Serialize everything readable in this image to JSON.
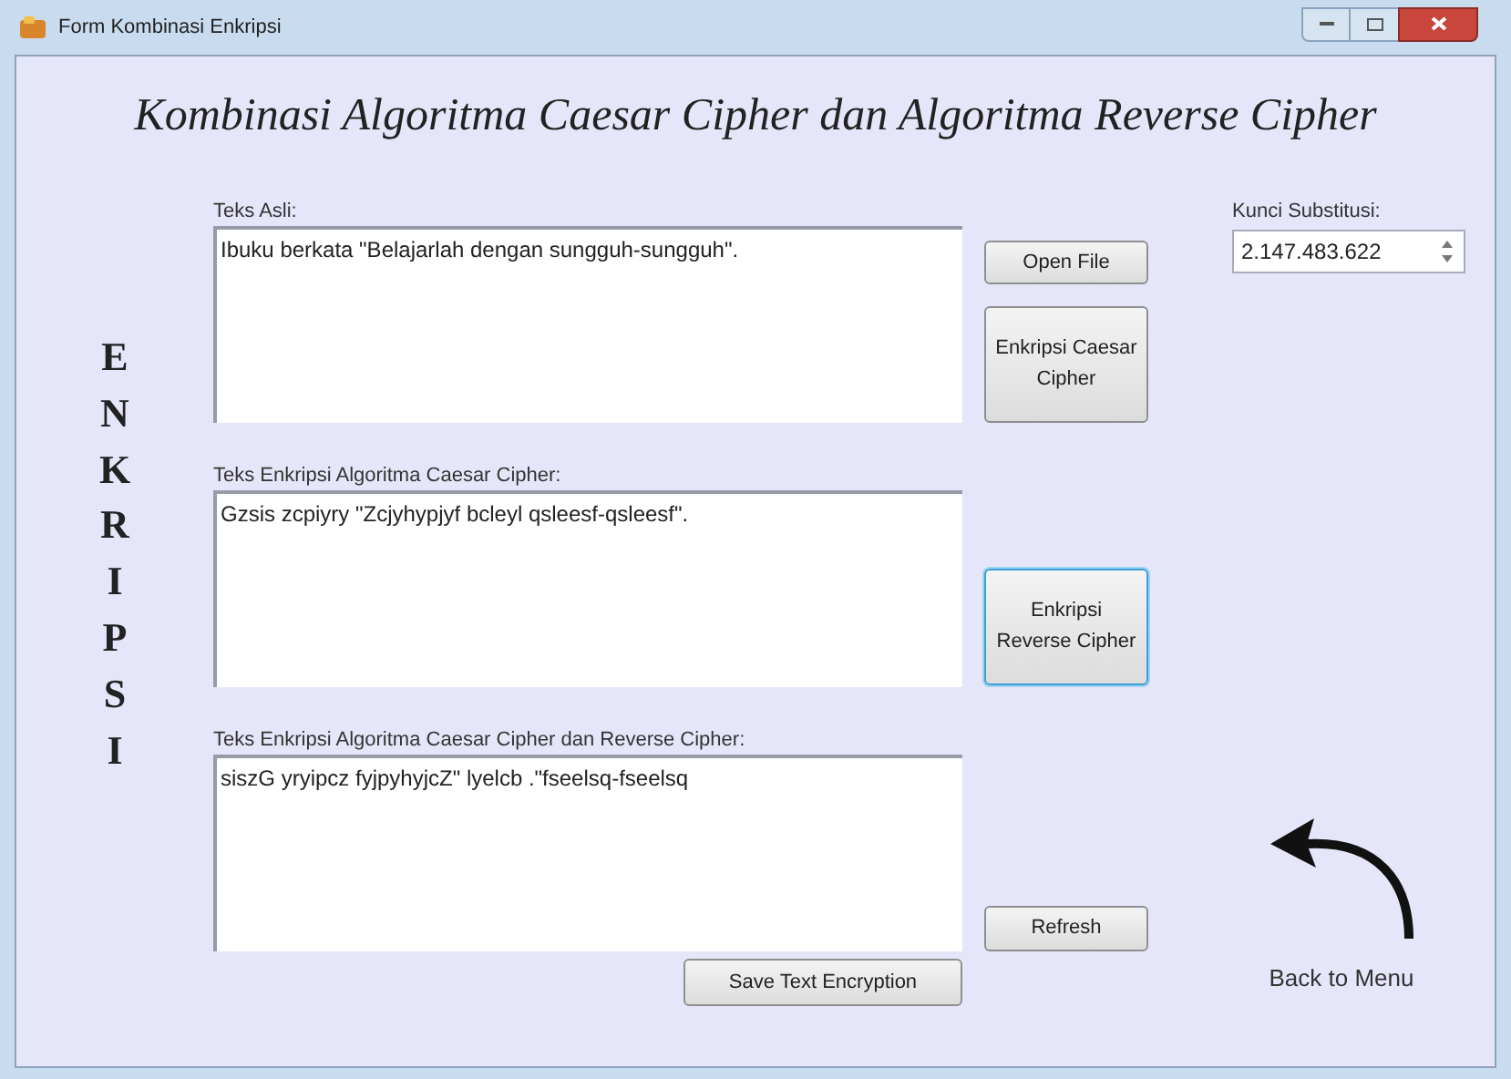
{
  "window": {
    "title": "Form Kombinasi Enkripsi"
  },
  "heading": "Kombinasi Algoritma Caesar Cipher dan Algoritma Reverse Cipher",
  "side_label": "ENKRIPSI",
  "fields": [
    {
      "label": "Teks Asli:",
      "value": "Ibuku berkata \"Belajarlah dengan sungguh-sungguh\"."
    },
    {
      "label": "Teks Enkripsi Algoritma Caesar Cipher:",
      "value": "Gzsis zcpiyry \"Zcjyhypjyf bcleyl qsleesf-qsleesf\"."
    },
    {
      "label": "Teks Enkripsi Algoritma Caesar Cipher dan Reverse Cipher:",
      "value": "siszG yryipcz fyjpyhyjcZ\" lyelcb .\"fseelsq-fseelsq"
    }
  ],
  "buttons": [
    {
      "label": "Open File",
      "focused": false
    },
    {
      "label": "Enkripsi Caesar Cipher",
      "focused": false
    },
    {
      "label": "Enkripsi Reverse Cipher",
      "focused": true
    },
    {
      "label": "Refresh",
      "focused": false
    },
    {
      "label": "Save Text Encryption",
      "focused": false
    }
  ],
  "key": {
    "label": "Kunci Substitusi:",
    "value": "2.147.483.622"
  },
  "back_link": "Back to Menu"
}
